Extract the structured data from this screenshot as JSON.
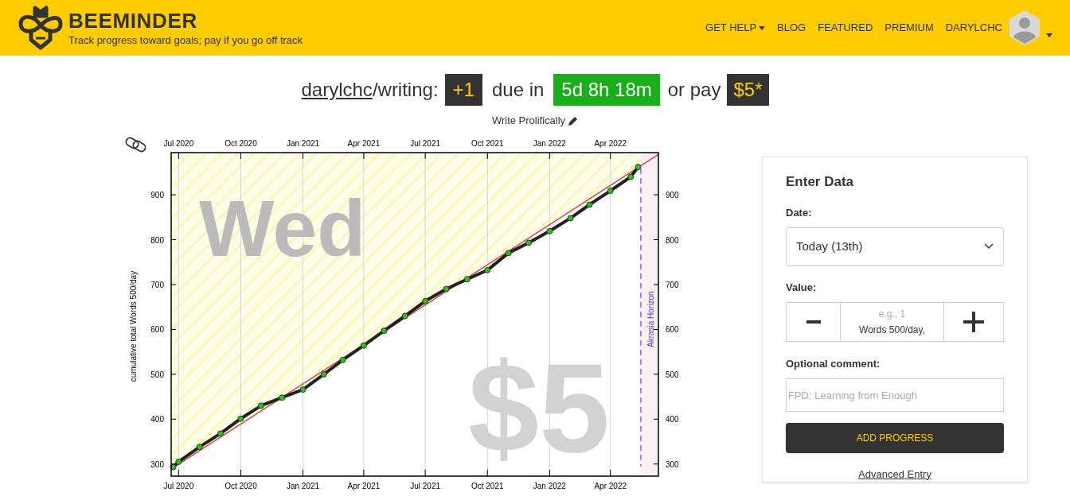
{
  "header": {
    "logo_text": "BEEMINDER",
    "tagline": "Track progress toward goals; pay if you go off track",
    "nav": [
      {
        "label": "GET HELP",
        "dropdown": true
      },
      {
        "label": "BLOG",
        "dropdown": false
      },
      {
        "label": "FEATURED",
        "dropdown": false
      },
      {
        "label": "PREMIUM",
        "dropdown": false
      },
      {
        "label": "DARYLCHC",
        "dropdown": false
      }
    ],
    "user_menu_dropdown": true
  },
  "goal": {
    "user": "darylchc",
    "slug": "/writing:",
    "delta": "+1",
    "due_label": "due in",
    "countdown": "5d 8h 18m",
    "pay_label": "or pay",
    "pledge": "$5*",
    "subtitle": "Write Prolifically"
  },
  "graph": {
    "day_watermark": "Wed",
    "amount_watermark": "$5",
    "top_axis_labels": [
      "Jul 2020",
      "Oct 2020",
      "Jan 2021",
      "Apr 2021",
      "Jul 2021",
      "Oct 2021",
      "Jan 2022",
      "Apr 2022"
    ],
    "right_axis_labels": [
      "900",
      "800",
      "700",
      "600",
      "500",
      "400",
      "300"
    ],
    "chart_data": {
      "type": "line",
      "grid": true,
      "ylabel": "cumulative total Words 500/day",
      "xlim": [
        "2020-06-20",
        "2022-06-11"
      ],
      "ylim": [
        273,
        994
      ],
      "xticks": [
        {
          "value": "2020-07-01",
          "label": "Jul 2020"
        },
        {
          "value": "2020-10-01",
          "label": "Oct 2020"
        },
        {
          "value": "2021-01-01",
          "label": "Jan 2021"
        },
        {
          "value": "2021-04-01",
          "label": "Apr 2021"
        },
        {
          "value": "2021-07-01",
          "label": "Jul 2021"
        },
        {
          "value": "2021-10-01",
          "label": "Oct 2021"
        },
        {
          "value": "2022-01-01",
          "label": "Jan 2022"
        },
        {
          "value": "2022-04-01",
          "label": "Apr 2022"
        }
      ],
      "yticks": [
        {
          "value": 300,
          "label": "300"
        },
        {
          "value": 400,
          "label": "400"
        },
        {
          "value": 500,
          "label": "500"
        },
        {
          "value": 600,
          "label": "600"
        },
        {
          "value": 700,
          "label": "700"
        },
        {
          "value": 800,
          "label": "800"
        },
        {
          "value": 900,
          "label": "900"
        }
      ],
      "ref_lines": [
        {
          "axis": "x",
          "value": "2022-05-16",
          "label": "Akrasia Horizon"
        }
      ],
      "bands": [
        {
          "axis": "x",
          "from": "2022-05-16",
          "to": "2022-06-11",
          "color": "#fdf0f4"
        }
      ],
      "series": [
        {
          "color": "#dd2222",
          "x": [
            "2020-06-20",
            "2022-06-11"
          ],
          "values": [
            289,
            990
          ]
        },
        {
          "color": "#33bb22",
          "marker": "circle",
          "x": [
            "2020-06-23",
            "2020-07-01",
            "2020-08-01",
            "2020-09-01",
            "2020-10-01",
            "2020-10-31",
            "2020-12-01",
            "2021-01-01",
            "2021-02-01",
            "2021-03-01",
            "2021-04-01",
            "2021-05-01",
            "2021-06-01",
            "2021-07-01",
            "2021-08-01",
            "2021-09-01",
            "2021-10-01",
            "2021-11-01",
            "2021-12-01",
            "2022-01-01",
            "2022-02-01",
            "2022-03-01",
            "2022-04-01",
            "2022-05-01",
            "2022-05-12"
          ],
          "values": [
            293,
            305,
            338,
            368,
            401,
            430,
            448,
            466,
            500,
            532,
            564,
            597,
            630,
            663,
            690,
            712,
            732,
            770,
            793,
            819,
            848,
            878,
            909,
            940,
            962
          ]
        }
      ]
    }
  },
  "enter_data": {
    "title": "Enter Data",
    "date_label": "Date:",
    "date_value": "Today (13th)",
    "value_label": "Value:",
    "value_placeholder": "e.g., 1",
    "value_unit": "Words 500/day,",
    "comment_label": "Optional comment:",
    "comment_placeholder": "FPD: Learning from Enough",
    "submit": "ADD PROGRESS",
    "advanced_link": "Advanced Entry"
  }
}
